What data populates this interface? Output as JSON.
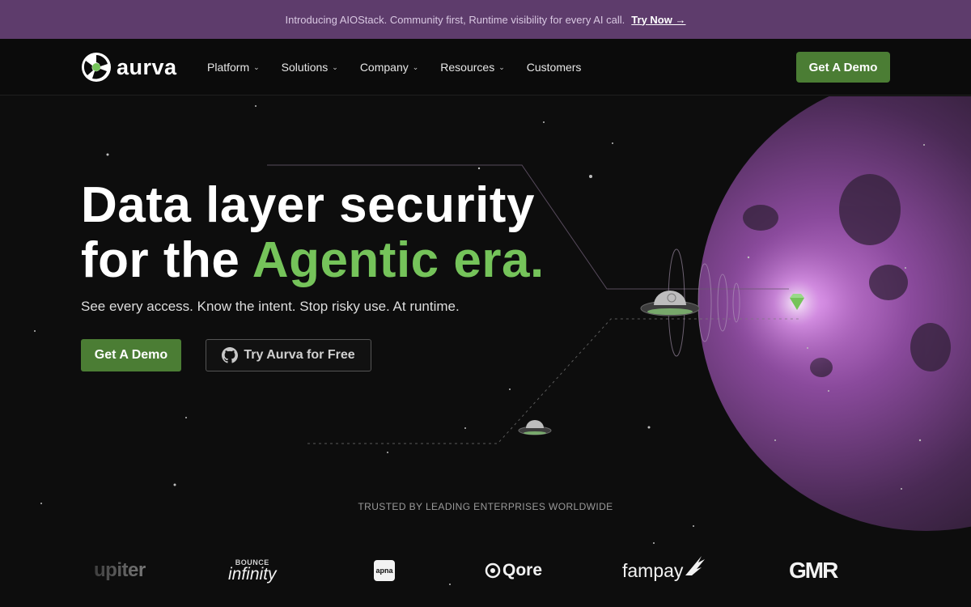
{
  "banner": {
    "message": "Introducing AIOStack. Community first, Runtime visibility for every AI call.",
    "link_label": "Try Now →"
  },
  "nav": {
    "logo_text": "aurva",
    "items": [
      {
        "label": "Platform",
        "dropdown": true
      },
      {
        "label": "Solutions",
        "dropdown": true
      },
      {
        "label": "Company",
        "dropdown": true
      },
      {
        "label": "Resources",
        "dropdown": true
      },
      {
        "label": "Customers",
        "dropdown": false
      }
    ],
    "cta_label": "Get A Demo"
  },
  "hero": {
    "headline_line1": "Data layer security",
    "headline_prefix": "for the ",
    "headline_accent": "Agentic era.",
    "subline": "See every access. Know the intent. Stop risky use. At runtime.",
    "primary_cta": "Get A Demo",
    "secondary_cta": "Try Aurva for Free"
  },
  "trusted": {
    "heading": "TRUSTED BY LEADING ENTERPRISES WORLDWIDE",
    "logos": [
      {
        "name": "upiter"
      },
      {
        "name": "BOUNCE",
        "sub": "infinity"
      },
      {
        "name": "apna"
      },
      {
        "name": "Qore"
      },
      {
        "name": "fampay"
      },
      {
        "name": "GMR"
      }
    ]
  },
  "colors": {
    "banner_bg": "#5e3c6c",
    "accent_green": "#75c35a",
    "button_green": "#4b7d34",
    "background": "#0d0d0d",
    "planet": "#8a4a9c"
  },
  "icons": [
    "chevron-down-icon",
    "github-icon",
    "ufo-icon",
    "gem-icon",
    "aurva-logo-icon"
  ]
}
